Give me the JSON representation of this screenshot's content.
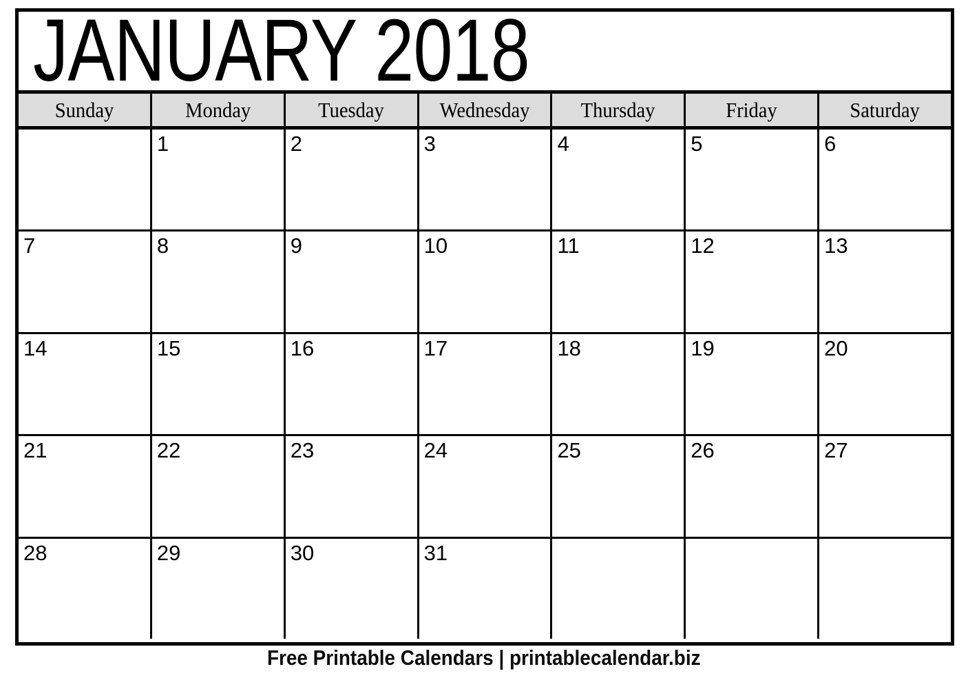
{
  "document": {
    "type": "printable-monthly-calendar",
    "month": "JANUARY",
    "year": "2018",
    "title": "JANUARY 2018"
  },
  "weekday_headers": [
    "Sunday",
    "Monday",
    "Tuesday",
    "Wednesday",
    "Thursday",
    "Friday",
    "Saturday"
  ],
  "weeks": [
    [
      "",
      "1",
      "2",
      "3",
      "4",
      "5",
      "6"
    ],
    [
      "7",
      "8",
      "9",
      "10",
      "11",
      "12",
      "13"
    ],
    [
      "14",
      "15",
      "16",
      "17",
      "18",
      "19",
      "20"
    ],
    [
      "21",
      "22",
      "23",
      "24",
      "25",
      "26",
      "27"
    ],
    [
      "28",
      "29",
      "30",
      "31",
      "",
      "",
      ""
    ]
  ],
  "footer": {
    "text": "Free Printable Calendars | printablecalendar.biz"
  },
  "colors": {
    "page_background": "#ffffff",
    "grid_line": "#000000",
    "weekday_header_background": "#dcdcdc",
    "text": "#000000"
  }
}
